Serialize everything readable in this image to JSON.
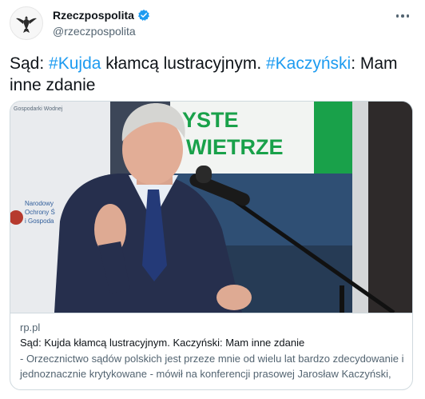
{
  "author": {
    "display_name": "Rzeczpospolita",
    "handle": "@rzeczpospolita",
    "verified": true,
    "avatar_icon": "eagle-logo-icon"
  },
  "tweet": {
    "text_part1": "Sąd: ",
    "hashtag1": "#Kujda",
    "text_part2": " kłamcą lustracyjnym. ",
    "hashtag2": "#Kaczyński",
    "text_part3": ": Mam inne zdanie"
  },
  "card": {
    "image_alt": "Speaker at a microphone on a conference stage",
    "banner_text_line1": "YSTE",
    "banner_text_line2": "WIETRZE",
    "sign_text_top": "Gospodarki Wodnej",
    "sign_text_left_1": "Narodowy",
    "sign_text_left_2": "Ochrony Ś",
    "sign_text_left_3": "i Gospoda",
    "domain": "rp.pl",
    "title": "Sąd: Kujda kłamcą lustracyjnym. Kaczyński: Mam inne zdanie",
    "description": "- Orzecznictwo sądów polskich jest przeze mnie od wielu lat bardzo zdecydowanie i jednoznacznie krytykowane - mówił na konferencji prasowej Jarosław Kaczyński,"
  },
  "colors": {
    "hashtag": "#1d9bf0",
    "verified": "#1d9bf0",
    "banner_green": "#19a14a",
    "suit": "#262f4d"
  }
}
